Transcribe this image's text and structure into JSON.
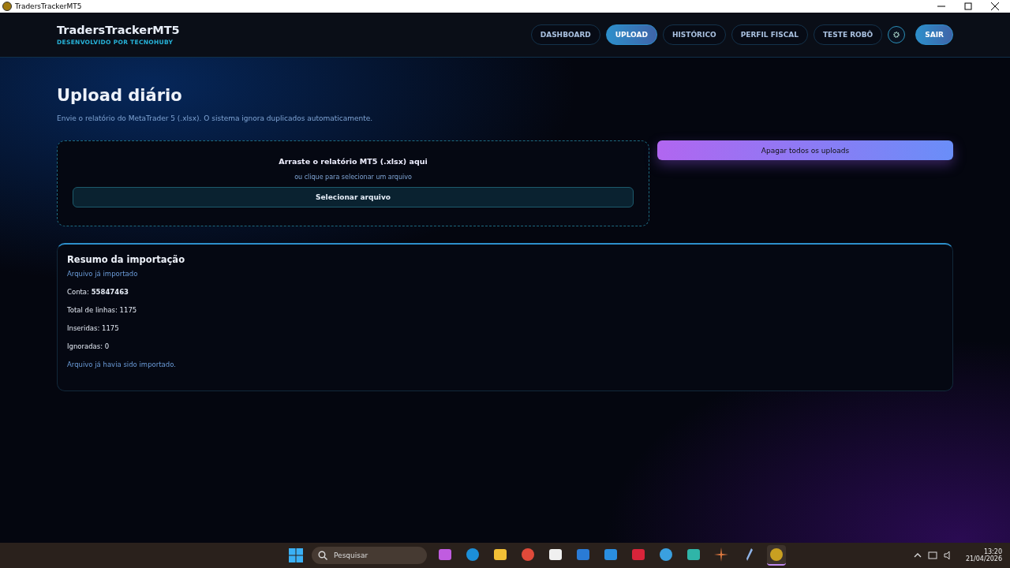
{
  "window": {
    "title": "TradersTrackerMT5"
  },
  "header": {
    "brand": "TradersTrackerMT5",
    "tagline": "DESENVOLVIDO POR TECNOHUBY",
    "nav": [
      {
        "label": "DASHBOARD",
        "selected": false
      },
      {
        "label": "UPLOAD",
        "selected": true
      },
      {
        "label": "HISTÓRICO",
        "selected": false
      },
      {
        "label": "PERFIL FISCAL",
        "selected": false
      },
      {
        "label": "TESTE ROBÔ",
        "selected": false
      }
    ],
    "logout": "SAIR"
  },
  "page": {
    "title": "Upload diário",
    "subtitle": "Envie o relatório do MetaTrader 5 (.xlsx). O sistema ignora duplicados automaticamente."
  },
  "dropzone": {
    "title": "Arraste o relatório MT5 (.xlsx) aqui",
    "hint": "ou clique para selecionar um arquivo",
    "button": "Selecionar arquivo"
  },
  "delete_button": "Apagar todos os uploads",
  "summary": {
    "title": "Resumo da importação",
    "status": "Arquivo já importado",
    "lines": [
      "Conta: **55847463**",
      "Total de linhas: 1175",
      "Inseridas: 1175",
      "Ignoradas: 0"
    ],
    "message": "Arquivo já havia sido importado."
  },
  "taskbar": {
    "search": "Pesquisar",
    "apps": [
      {
        "kind": "copilot",
        "selected": false
      },
      {
        "kind": "edge",
        "selected": false
      },
      {
        "kind": "folder",
        "selected": false
      },
      {
        "kind": "chrome",
        "selected": false
      },
      {
        "kind": "store",
        "selected": false
      },
      {
        "kind": "mail",
        "selected": false
      },
      {
        "kind": "code",
        "selected": false
      },
      {
        "kind": "red",
        "selected": false
      },
      {
        "kind": "telegram",
        "selected": false
      },
      {
        "kind": "screen",
        "selected": false
      },
      {
        "kind": "burst",
        "selected": false
      },
      {
        "kind": "feather",
        "selected": false
      },
      {
        "kind": "coin",
        "selected": true
      }
    ],
    "time": "13:20",
    "date": "21/04/2026"
  }
}
